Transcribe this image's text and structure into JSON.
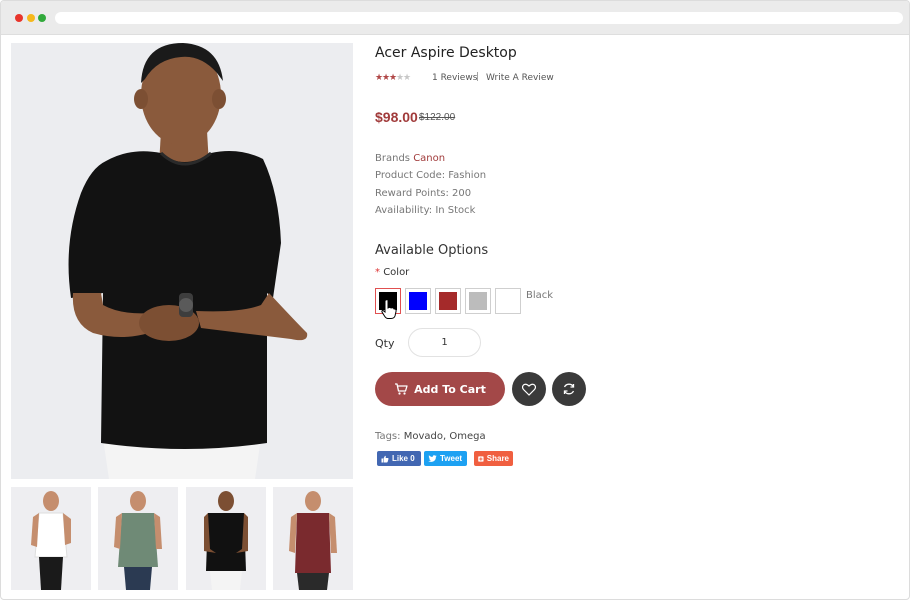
{
  "product": {
    "title": "Acer Aspire Desktop",
    "rating": 3,
    "rating_max": 5,
    "reviews_link": "1 Reviews",
    "separator": "|",
    "write_review": "Write A Review",
    "price_new": "$98.00",
    "price_old": "$122.00",
    "brand_label": "Brands",
    "brand_value": "Canon",
    "product_code": "Product Code: Fashion",
    "reward_points": "Reward Points: 200",
    "availability": "Availability: In Stock"
  },
  "options": {
    "title": "Available Options",
    "required_mark": "*",
    "color_label": "Color",
    "selected_color_name": "Black",
    "swatches": [
      "#000000",
      "#0000ff",
      "#a52a2a",
      "#bcbcbc",
      "#ffffff"
    ]
  },
  "quantity": {
    "label": "Qty",
    "value": "1"
  },
  "actions": {
    "add_to_cart": "Add To Cart"
  },
  "tags": {
    "label": "Tags:",
    "items": [
      "Movado",
      "Omega"
    ],
    "separator": ","
  },
  "social": {
    "like": "Like 0",
    "tweet": "Tweet",
    "share": "Share"
  },
  "colors": {
    "accent": "#a34848",
    "facebook": "#4267b2",
    "twitter": "#1da1f2",
    "share": "#f05f40"
  }
}
